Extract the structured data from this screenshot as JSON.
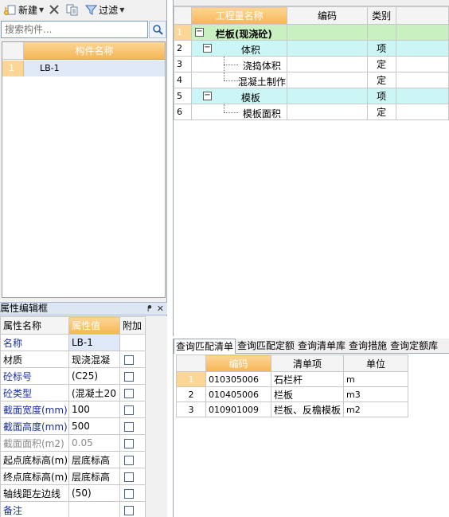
{
  "toolbar": {
    "new_label": "新建",
    "filter_label": "过滤"
  },
  "search": {
    "placeholder": "搜索构件..."
  },
  "component_list": {
    "header": "构件名称",
    "rows": [
      {
        "num": "1",
        "name": "LB-1"
      }
    ]
  },
  "properties": {
    "title": "属性编辑框",
    "pin_icon": "pin-icon",
    "close_icon": "close-icon",
    "headers": [
      "属性名称",
      "属性值",
      "附加"
    ],
    "rows": [
      {
        "name": "名称",
        "value": "LB-1"
      },
      {
        "name": "材质",
        "value": "现浇混凝"
      },
      {
        "name": "砼标号",
        "value": "(C25)"
      },
      {
        "name": "砼类型",
        "value": "(混凝土20"
      },
      {
        "name": "截面宽度(mm)",
        "value": "100"
      },
      {
        "name": "截面高度(mm)",
        "value": "500"
      },
      {
        "name": "截面面积(m2)",
        "value": "0.05"
      },
      {
        "name": "起点底标高(m)",
        "value": "层底标高"
      },
      {
        "name": "终点底标高(m)",
        "value": "层底标高"
      },
      {
        "name": "轴线距左边线",
        "value": "(50)"
      },
      {
        "name": "备注",
        "value": ""
      }
    ]
  },
  "quantity_grid": {
    "headers": [
      "工程量名称",
      "编码",
      "类别"
    ],
    "rows": [
      {
        "num": "1",
        "name": "栏板(现浇砼)",
        "code": "",
        "type": ""
      },
      {
        "num": "2",
        "name": "体积",
        "code": "",
        "type": "项"
      },
      {
        "num": "3",
        "name": "浇捣体积",
        "code": "",
        "type": "定"
      },
      {
        "num": "4",
        "name": "混凝土制作",
        "code": "",
        "type": "定"
      },
      {
        "num": "5",
        "name": "模板",
        "code": "",
        "type": "项"
      },
      {
        "num": "6",
        "name": "模板面积",
        "code": "",
        "type": "定"
      }
    ]
  },
  "query_tabs": [
    "查询匹配清单",
    "查询匹配定额",
    "查询清单库",
    "查询措施",
    "查询定额库"
  ],
  "query_grid": {
    "headers": [
      "编码",
      "清单项",
      "单位"
    ],
    "rows": [
      {
        "num": "1",
        "code": "010305006",
        "name": "石栏杆",
        "unit": "m"
      },
      {
        "num": "2",
        "code": "010405006",
        "name": "栏板",
        "unit": "m3"
      },
      {
        "num": "3",
        "code": "010901009",
        "name": "栏板、反檐模板",
        "unit": "m2"
      }
    ]
  },
  "colors": {
    "header_orange": "#f6b653",
    "row_green": "#c8f0c0",
    "row_cyan": "#ccf6f6",
    "selection_blue": "#dfe8f6"
  }
}
